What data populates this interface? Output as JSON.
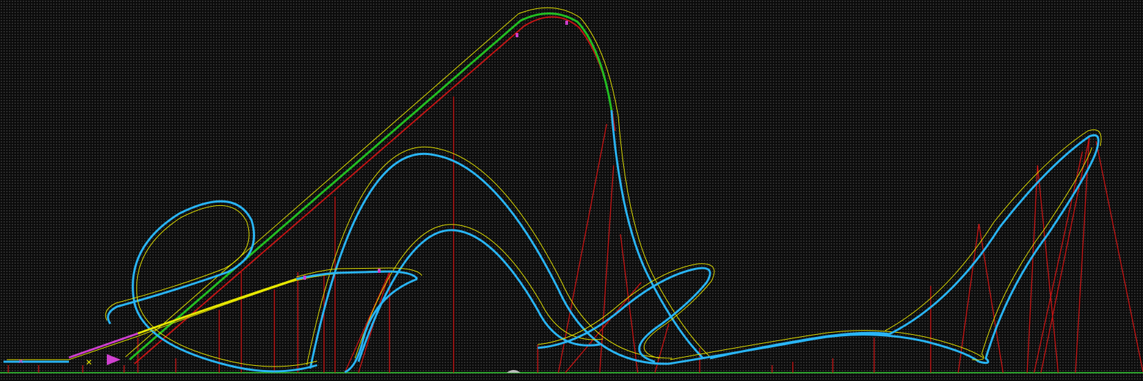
{
  "view": {
    "type": "coaster-track-side-profile",
    "colors": {
      "background": "#0b0b0b",
      "grid_dot": "#3a3a3a",
      "ground": "#2ea82e",
      "support": "#c81414",
      "track_main": "#29b6f6",
      "track_guide": "#e8e800",
      "lift_segment": "#22c022",
      "lift_chain": "#c81414",
      "brake_segment": "#e8e800",
      "launch_segment": "#d040d0",
      "station_marker": "#d040d0"
    },
    "segments": [
      "station",
      "launch",
      "lift-hill",
      "first-drop",
      "vertical-loop",
      "camelback-hill",
      "second-hill",
      "cobra-loop",
      "overbank-turn",
      "brake-run",
      "top-hat-spike"
    ],
    "markers": [
      "launch-arrow",
      "brake-x-marker",
      "camera-marker"
    ]
  }
}
